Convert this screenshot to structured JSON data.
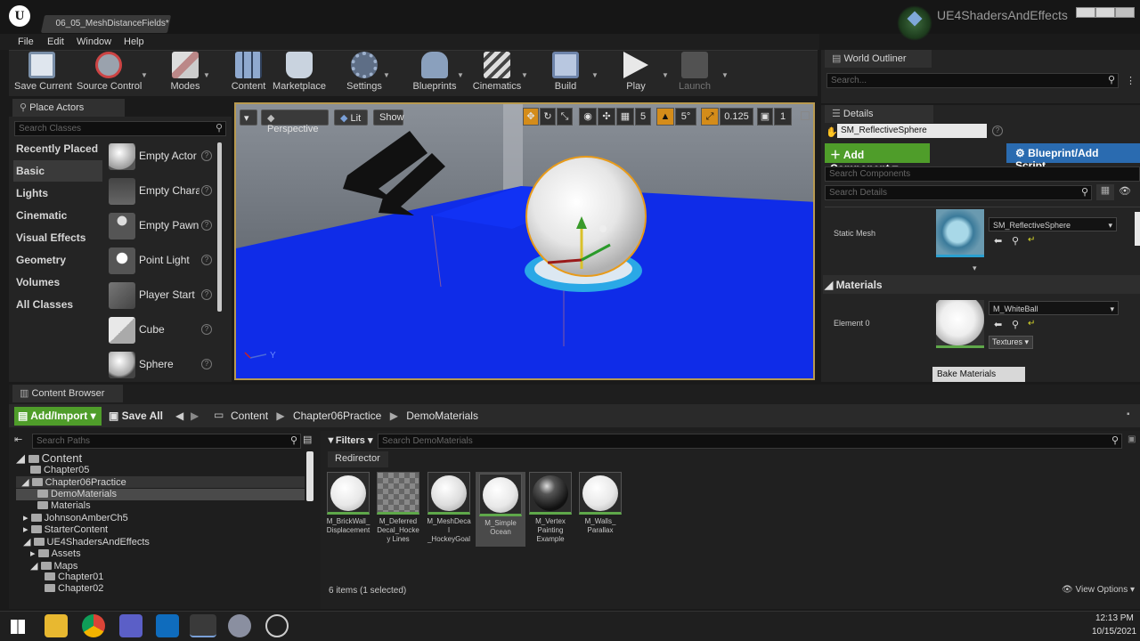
{
  "window": {
    "tab_title": "06_05_MeshDistanceFields*",
    "project": "UE4ShadersAndEffects"
  },
  "menu": [
    "File",
    "Edit",
    "Window",
    "Help"
  ],
  "toolbar": [
    {
      "label": "Save Current",
      "icon": "save-icon"
    },
    {
      "label": "Source Control",
      "icon": "source-control-icon"
    },
    {
      "label": "Modes",
      "icon": "modes-icon"
    },
    {
      "label": "Content",
      "icon": "content-icon"
    },
    {
      "label": "Marketplace",
      "icon": "marketplace-icon"
    },
    {
      "label": "Settings",
      "icon": "settings-icon"
    },
    {
      "label": "Blueprints",
      "icon": "blueprints-icon"
    },
    {
      "label": "Cinematics",
      "icon": "cinematics-icon"
    },
    {
      "label": "Build",
      "icon": "build-icon"
    },
    {
      "label": "Play",
      "icon": "play-icon"
    },
    {
      "label": "Launch",
      "icon": "launch-icon"
    }
  ],
  "place_actors": {
    "tab": "Place Actors",
    "search_placeholder": "Search Classes",
    "categories": [
      "Recently Placed",
      "Basic",
      "Lights",
      "Cinematic",
      "Visual Effects",
      "Geometry",
      "Volumes",
      "All Classes"
    ],
    "selected_category": "Basic",
    "actors": [
      "Empty Actor",
      "Empty Chara",
      "Empty Pawn",
      "Point Light",
      "Player Start",
      "Cube",
      "Sphere"
    ]
  },
  "viewport": {
    "perspective": "Perspective",
    "lit": "Lit",
    "show": "Show",
    "grid_snap": "5",
    "rotation_snap": "5°",
    "scale_snap": "0.125",
    "camera_speed": "1",
    "axis_label": "Y"
  },
  "world_outliner": {
    "tab": "World Outliner",
    "search_placeholder": "Search..."
  },
  "details": {
    "tab": "Details",
    "object_name": "SM_ReflectiveSphere",
    "add_component": "Add Component",
    "blueprint_script": "Blueprint/Add Script",
    "search_components": "Search Components",
    "search_details": "Search Details",
    "static_mesh_label": "Static Mesh",
    "static_mesh_value": "SM_ReflectiveSphere",
    "materials_section": "Materials",
    "element0_label": "Element 0",
    "element0_value": "M_WhiteBall",
    "textures_btn": "Textures",
    "bake_materials": "Bake Materials"
  },
  "content_browser": {
    "tab": "Content Browser",
    "add_import": "Add/Import",
    "save_all": "Save All",
    "breadcrumb": [
      "Content",
      "Chapter06Practice",
      "DemoMaterials"
    ],
    "search_paths": "Search Paths",
    "filters": "Filters",
    "search_assets": "Search DemoMaterials",
    "redirector": "Redirector",
    "tree": [
      {
        "label": "Content",
        "level": 0
      },
      {
        "label": "Chapter05",
        "level": 1
      },
      {
        "label": "Chapter06Practice",
        "level": 1
      },
      {
        "label": "DemoMaterials",
        "level": 2
      },
      {
        "label": "Materials",
        "level": 2
      },
      {
        "label": "JohnsonAmberCh5",
        "level": 1
      },
      {
        "label": "StarterContent",
        "level": 1
      },
      {
        "label": "UE4ShadersAndEffects",
        "level": 1
      },
      {
        "label": "Assets",
        "level": 2
      },
      {
        "label": "Maps",
        "level": 2
      },
      {
        "label": "Chapter01",
        "level": 3
      },
      {
        "label": "Chapter02",
        "level": 3
      }
    ],
    "assets": [
      {
        "name": "M_BrickWall_ Displacement"
      },
      {
        "name": "M_Deferred Decal_Hockey Lines"
      },
      {
        "name": "M_MeshDecal _HockeyGoal"
      },
      {
        "name": "M_Simple Ocean"
      },
      {
        "name": "M_Vertex Painting Example"
      },
      {
        "name": "M_Walls_ Parallax"
      }
    ],
    "status": "6 items (1 selected)",
    "view_options": "View Options"
  },
  "taskbar": {
    "time": "12:13 PM",
    "date": "10/15/2021"
  }
}
